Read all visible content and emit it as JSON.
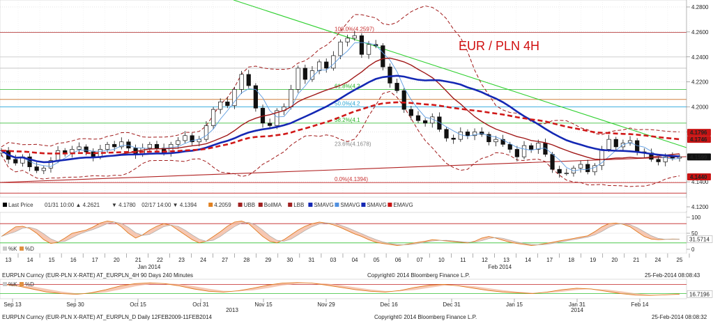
{
  "chart_data": {
    "type": "candlestick",
    "title": "EUR / PLN 4H",
    "title_color": "#d01010",
    "price_axis": {
      "ticks": [
        "4.2800",
        "4.2600",
        "4.2400",
        "4.2200",
        "4.2000",
        "4.1800",
        "4.1400",
        "4.1200"
      ],
      "ylim": [
        4.115,
        4.285
      ]
    },
    "price_tags": [
      {
        "value": 4.1796,
        "label": "4.1796",
        "color": "#c81414"
      },
      {
        "value": 4.1746,
        "label": "4.1746",
        "color": "#c81414"
      },
      {
        "value": 4.1599,
        "label": "4.1599",
        "color": "#111111"
      },
      {
        "value": 4.144,
        "label": "4.1440",
        "color": "#c81414"
      }
    ],
    "fibonacci": [
      {
        "label": "100.0%(4.2597)",
        "value": 4.2597,
        "color": "#c83030"
      },
      {
        "label": "61.8%(4.2",
        "value": 4.214,
        "color": "#20b020"
      },
      {
        "label": "50.0%(4.2",
        "value": 4.2,
        "color": "#20a0d0"
      },
      {
        "label": "38.2%(4.1",
        "value": 4.187,
        "color": "#20b020"
      },
      {
        "label": "23.6%(4.1678)",
        "value": 4.1678,
        "color": "#888888"
      },
      {
        "label": "0.0%(4.1394)",
        "value": 4.1394,
        "color": "#c83030"
      }
    ],
    "horizontal_levels": [
      4.2597,
      4.24,
      4.231,
      4.214,
      4.206,
      4.2,
      4.187,
      4.1394,
      4.131
    ],
    "legend": [
      {
        "label": "Last Price",
        "color": "#000000"
      },
      {
        "label": "01/31 10:00 ▲ 4.2621",
        "color": "#000000"
      },
      {
        "label": "▼ 4.1780",
        "color": "#000000"
      },
      {
        "label": "02/17 14:00 ▼ 4.1394",
        "color": "#000000"
      },
      {
        "label": "4.2059",
        "color": "#e08020"
      },
      {
        "label": "UBB",
        "color": "#a02020"
      },
      {
        "label": "BollMA",
        "color": "#a02020"
      },
      {
        "label": "LBB",
        "color": "#a02020"
      },
      {
        "label": "SMAVG",
        "color": "#1428b4"
      },
      {
        "label": "SMAVG",
        "color": "#5090e0"
      },
      {
        "label": "SMAVG",
        "color": "#1428b4"
      },
      {
        "label": "EMAVG",
        "color": "#c81414"
      }
    ],
    "x_days": [
      "13",
      "14",
      "15",
      "16",
      "17",
      "20",
      "21",
      "22",
      "23",
      "24",
      "27",
      "28",
      "29",
      "30",
      "31",
      "03",
      "04",
      "05",
      "06",
      "07",
      "10",
      "11",
      "12",
      "13",
      "14",
      "17",
      "18",
      "19",
      "20",
      "21",
      "24",
      "25"
    ],
    "month_labels": [
      {
        "label": "Jan 2014",
        "index": 6.5
      },
      {
        "label": "Feb 2014",
        "index": 22.7
      }
    ],
    "close": [
      4.165,
      4.158,
      4.155,
      4.16,
      4.152,
      4.149,
      4.151,
      4.157,
      4.165,
      4.163,
      4.166,
      4.168,
      4.164,
      4.16,
      4.166,
      4.17,
      4.168,
      4.172,
      4.167,
      4.162,
      4.167,
      4.17,
      4.167,
      4.163,
      4.17,
      4.173,
      4.177,
      4.172,
      4.174,
      4.185,
      4.198,
      4.204,
      4.201,
      4.214,
      4.226,
      4.217,
      4.199,
      4.187,
      4.185,
      4.197,
      4.2,
      4.214,
      4.231,
      4.222,
      4.229,
      4.236,
      4.231,
      4.241,
      4.252,
      4.255,
      4.257,
      4.242,
      4.25,
      4.249,
      4.232,
      4.219,
      4.213,
      4.198,
      4.193,
      4.189,
      4.187,
      4.192,
      4.182,
      4.175,
      4.174,
      4.18,
      4.177,
      4.18,
      4.178,
      4.172,
      4.174,
      4.17,
      4.166,
      4.16,
      4.169,
      4.166,
      4.171,
      4.162,
      4.15,
      4.147,
      4.147,
      4.151,
      4.154,
      4.148,
      4.153,
      4.166,
      4.174,
      4.168,
      4.171,
      4.173,
      4.164,
      4.163,
      4.158,
      4.156,
      4.16,
      4.159,
      4.16
    ],
    "stoch_axis": {
      "ticks": [
        "100",
        "50",
        "0"
      ],
      "last_value": "31.5714"
    },
    "stoch_k": [
      40,
      55,
      70,
      72,
      65,
      50,
      30,
      18,
      22,
      35,
      50,
      55,
      60,
      70,
      82,
      88,
      85,
      70,
      50,
      35,
      45,
      60,
      72,
      80,
      75,
      60,
      45,
      30,
      20,
      25,
      40,
      55,
      72,
      85,
      88,
      80,
      60,
      40,
      25,
      20,
      30,
      45,
      60,
      72,
      80,
      85,
      82,
      76,
      68,
      58,
      48,
      40,
      30,
      22,
      18,
      15,
      12,
      14,
      18,
      22,
      25,
      30,
      28,
      26,
      24,
      22,
      20,
      25,
      35,
      40,
      35,
      28,
      22,
      18,
      15,
      12,
      14,
      18,
      22,
      26,
      30,
      34,
      38,
      42,
      55,
      70,
      80,
      82,
      78,
      70,
      55,
      40,
      32,
      30,
      31,
      32,
      31.5
    ],
    "stoch_legend": [
      "%K",
      "%D"
    ],
    "daily_axis": {
      "last_value": "16.7196"
    },
    "daily_stoch": [
      80,
      70,
      50,
      30,
      20,
      15,
      25,
      45,
      70,
      85,
      90,
      85,
      70,
      50,
      35,
      30,
      38,
      55,
      75,
      88,
      92,
      88,
      75,
      60,
      45,
      35,
      30,
      40,
      60,
      75,
      80,
      70,
      55,
      40,
      30,
      25,
      20,
      30,
      45,
      55,
      50,
      35,
      20,
      10,
      8,
      12,
      16.7
    ],
    "daily_ticks": [
      "Sep 13",
      "Sep 30",
      "Oct 15",
      "Oct 31",
      "Nov 15",
      "Nov 29",
      "Dec 16",
      "Dec 31",
      "Jan 15",
      "Jan 31",
      "Feb 14"
    ],
    "daily_years": [
      {
        "label": "2013",
        "tick": 3.5
      },
      {
        "label": "2014",
        "tick": 9.0
      }
    ],
    "footer_top_left": "EURPLN Curncy (EUR-PLN X-RATE) AT_EURPLN_4H 90 Days 240 Minutes",
    "footer_top_center": "Copyright© 2014 Bloomberg Finance L.P.",
    "footer_top_right": "25-Feb-2014 08:08:43",
    "footer_bottom_left": "EURPLN Curncy (EUR-PLN X-RATE) AT_EURPLN_D  Daily 12FEB2009-11FEB2014",
    "footer_bottom_center": "Copyright© 2014 Bloomberg Finance L.P.",
    "footer_bottom_right": "25-Feb-2014 08:08:32"
  }
}
